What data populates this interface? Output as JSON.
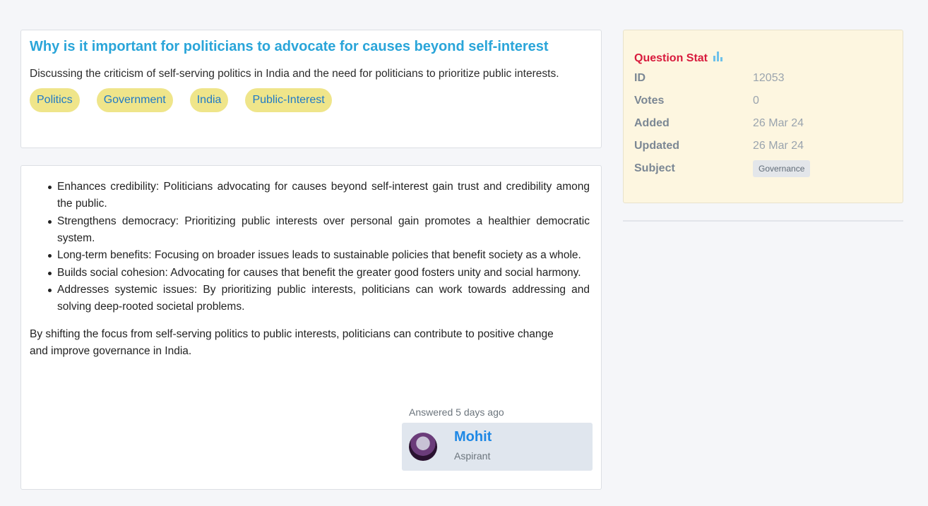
{
  "question": {
    "title": "Why is it important for politicians to advocate for causes beyond self-interest",
    "description": "Discussing the criticism of self-serving politics in India and the need for politicians to prioritize public interests.",
    "tags": [
      "Politics",
      "Government",
      "India",
      "Public-Interest"
    ]
  },
  "answer": {
    "points": [
      "Enhances credibility: Politicians advocating for causes beyond self-interest gain trust and credibility among the public.",
      "Strengthens democracy: Prioritizing public interests over personal gain promotes a healthier democratic system.",
      "Long-term benefits: Focusing on broader issues leads to sustainable policies that benefit society as a whole.",
      "Builds social cohesion: Advocating for causes that benefit the greater good fosters unity and social harmony.",
      "Addresses systemic issues: By prioritizing public interests, politicians can work towards addressing and solving deep-rooted societal problems."
    ],
    "conclusion": "By shifting the focus from self-serving politics to public interests, politicians can contribute to positive change and improve governance in India.",
    "answered_meta": "Answered 5 days ago",
    "author": {
      "name": "Mohit",
      "role": "Aspirant"
    }
  },
  "stats": {
    "title": "Question Stat",
    "rows": {
      "id": {
        "label": "ID",
        "value": "12053"
      },
      "votes": {
        "label": "Votes",
        "value": "0"
      },
      "added": {
        "label": "Added",
        "value": "26 Mar 24"
      },
      "updated": {
        "label": "Updated",
        "value": "26 Mar 24"
      },
      "subject": {
        "label": "Subject",
        "value": "Governance"
      }
    }
  },
  "icons": {
    "chart": "bar-chart-icon"
  },
  "colors": {
    "title": "#2aa5d9",
    "tag_bg": "#efe58a",
    "tag_text": "#1f7ac7",
    "stat_title": "#d81b3d",
    "stat_bg": "#fdf6e0",
    "author_name": "#1e88e5"
  }
}
